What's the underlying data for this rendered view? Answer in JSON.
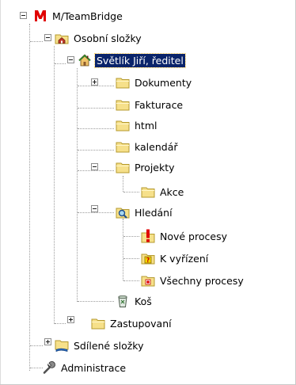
{
  "colors": {
    "folder": "#f6e08a",
    "folder_edge": "#b59a2f",
    "selection": "#0a246a",
    "logo_red": "#e00000",
    "tree_line": "#9c9c9c"
  },
  "tree": {
    "root": {
      "label": "M/TeamBridge",
      "icon": "brand-logo-icon"
    },
    "personal": {
      "label": "Osobní složky",
      "icon": "home-folder-icon"
    },
    "user": {
      "label": "Světlík Jiří, ředitel",
      "icon": "house-icon"
    },
    "dokumenty": {
      "label": "Dokumenty",
      "icon": "folder-icon"
    },
    "fakturace": {
      "label": "Fakturace",
      "icon": "folder-icon"
    },
    "html": {
      "label": "html",
      "icon": "folder-icon"
    },
    "kalendar": {
      "label": "kalendář",
      "icon": "folder-icon"
    },
    "projekty": {
      "label": "Projekty",
      "icon": "folder-icon"
    },
    "akce": {
      "label": "Akce",
      "icon": "folder-icon"
    },
    "hledani": {
      "label": "Hledání",
      "icon": "search-folder-icon"
    },
    "nove_procesy": {
      "label": "Nové procesy",
      "icon": "alert-folder-icon"
    },
    "k_vyrizeni": {
      "label": "K vyřízení",
      "icon": "question-folder-icon"
    },
    "vsechny_procesy": {
      "label": "Všechny procesy",
      "icon": "process-folder-icon"
    },
    "kos": {
      "label": "Koš",
      "icon": "trash-icon"
    },
    "zastupovani": {
      "label": "Zastupovaní",
      "icon": "folder-icon"
    },
    "shared": {
      "label": "Sdílené složky",
      "icon": "shared-folder-icon"
    },
    "admin": {
      "label": "Administrace",
      "icon": "wrench-icon"
    }
  }
}
